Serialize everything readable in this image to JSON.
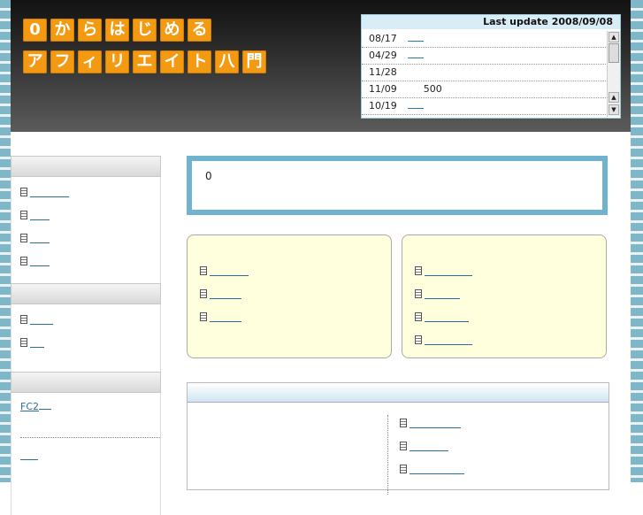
{
  "header": {
    "logo_line1": [
      "0",
      "か",
      "ら",
      "は",
      "じ",
      "め",
      "る"
    ],
    "logo_line2": [
      "ア",
      "フ",
      "ィ",
      "リ",
      "エ",
      "イ",
      "ト",
      "八",
      "門"
    ],
    "last_update": "Last update 2008/09/08",
    "updates": [
      {
        "date": "08/17",
        "text": "",
        "link": true
      },
      {
        "date": "04/29",
        "text": "",
        "link": true
      },
      {
        "date": "11/28",
        "text": "",
        "link": false
      },
      {
        "date": "11/09",
        "text": "500",
        "link": false
      },
      {
        "date": "10/19",
        "text": "",
        "link": true
      }
    ]
  },
  "sidebar": {
    "section1_items": [
      "",
      "",
      "",
      ""
    ],
    "section2_items": [
      "",
      ""
    ],
    "section3_link": "FC2",
    "section3_link2": ""
  },
  "notice": {
    "text": "0"
  },
  "left_box_items": [
    "",
    "",
    ""
  ],
  "right_box_items": [
    "",
    "",
    "",
    ""
  ],
  "panel_items": [
    "",
    "",
    ""
  ]
}
